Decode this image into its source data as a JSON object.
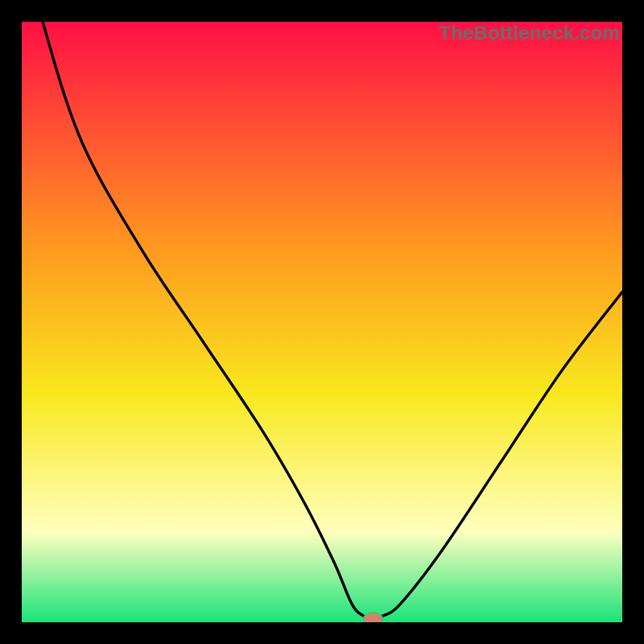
{
  "watermark": "TheBottleneck.com",
  "colors": {
    "gradient_top": "#ff0f45",
    "gradient_mid1": "#ff9a1f",
    "gradient_mid2": "#f9e81e",
    "gradient_pale": "#feffbe",
    "gradient_bottom": "#1be37a",
    "curve_stroke": "#000000",
    "marker_fill": "#d8806b",
    "marker_stroke": "#2ccf6e",
    "frame_bg": "#000000"
  },
  "chart_data": {
    "type": "line",
    "title": "",
    "xlabel": "",
    "ylabel": "",
    "xlim": [
      0,
      100
    ],
    "ylim": [
      0,
      100
    ],
    "grid": false,
    "legend": false,
    "annotations": [
      "TheBottleneck.com"
    ],
    "series": [
      {
        "name": "bottleneck-curve",
        "x": [
          0,
          3.5,
          10,
          20,
          30,
          40,
          47,
          52,
          55,
          57,
          58.5,
          60,
          63,
          70,
          80,
          90,
          100
        ],
        "y": [
          115,
          100,
          80,
          62,
          47,
          32,
          20,
          10,
          3,
          1,
          0.5,
          1,
          3,
          12,
          27,
          42,
          55
        ]
      }
    ],
    "marker": {
      "x": 58.5,
      "y": 0.5,
      "rx": 1.6,
      "ry": 1.1
    }
  }
}
